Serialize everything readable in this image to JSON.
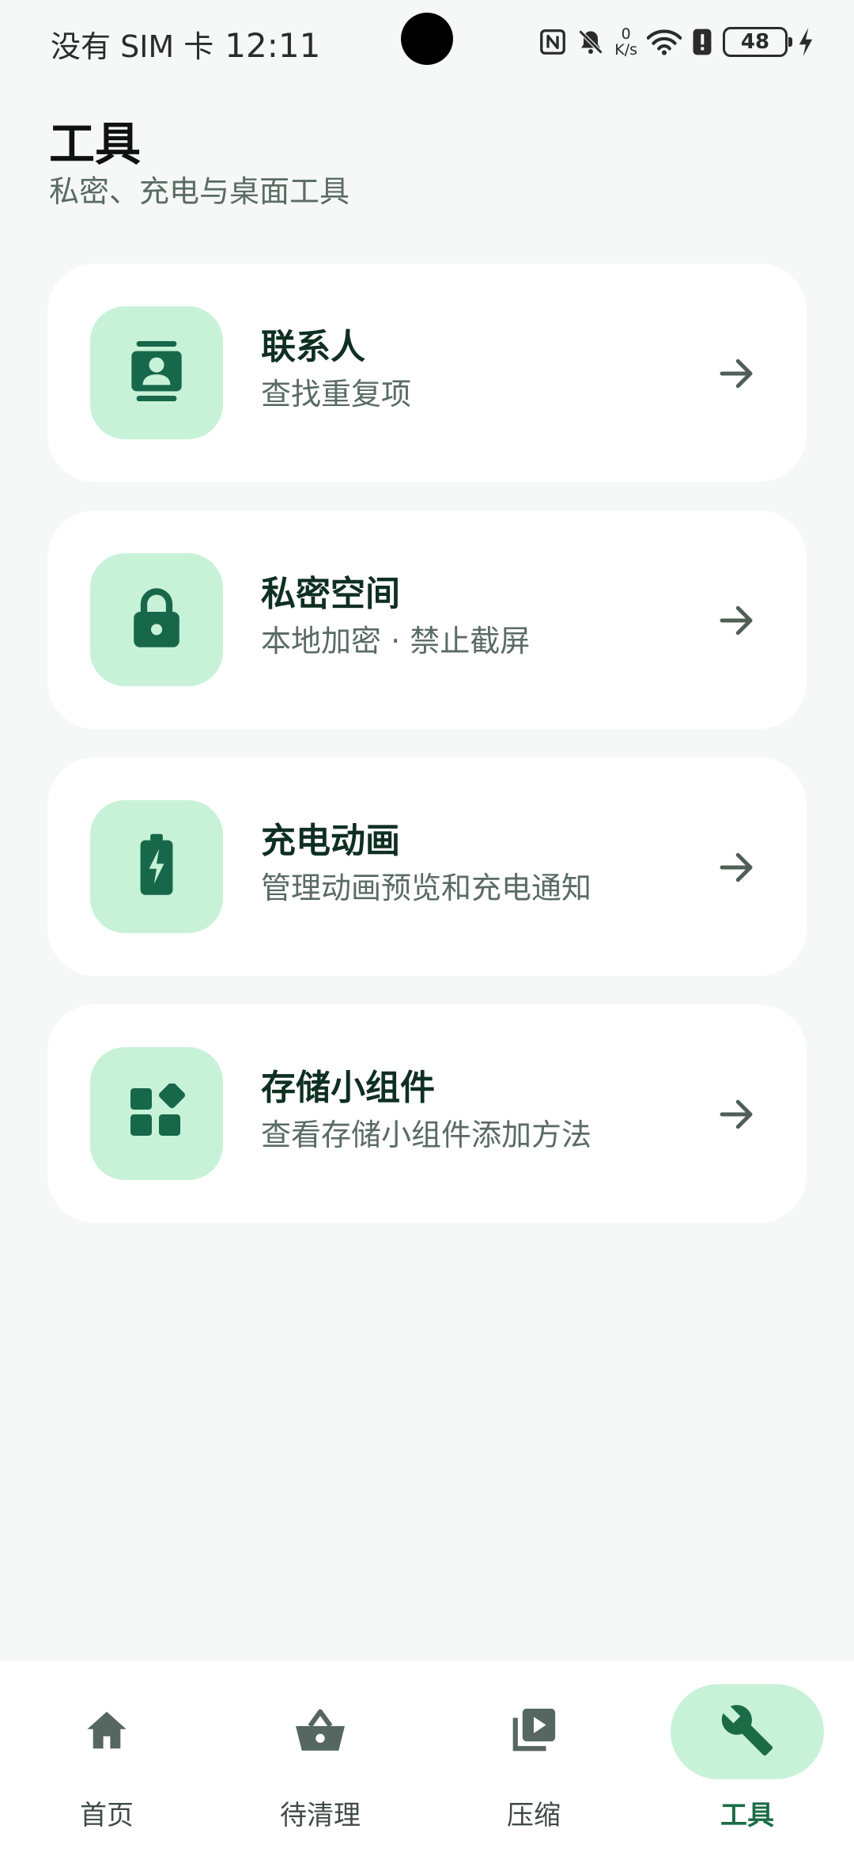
{
  "status_bar": {
    "carrier": "没有 SIM 卡",
    "time": "12:11",
    "net_speed_value": "0",
    "net_speed_unit": "K/s",
    "battery_level": "48",
    "icons": [
      "nfc-icon",
      "mute-icon",
      "wifi-icon",
      "alert-icon",
      "battery-icon",
      "charging-icon"
    ]
  },
  "header": {
    "title": "工具",
    "subtitle": "私密、充电与桌面工具"
  },
  "tools": [
    {
      "title": "联系人",
      "desc": "查找重复项",
      "icon": "contacts-icon"
    },
    {
      "title": "私密空间",
      "desc": "本地加密 · 禁止截屏",
      "icon": "lock-icon"
    },
    {
      "title": "充电动画",
      "desc": "管理动画预览和充电通知",
      "icon": "battery-charging-icon"
    },
    {
      "title": "存储小组件",
      "desc": "查看存储小组件添加方法",
      "icon": "widgets-icon"
    }
  ],
  "nav": {
    "active": "工具",
    "items": [
      {
        "label": "首页",
        "icon": "home-icon"
      },
      {
        "label": "待清理",
        "icon": "basket-icon"
      },
      {
        "label": "压缩",
        "icon": "video-library-icon"
      },
      {
        "label": "工具",
        "icon": "wrench-icon"
      }
    ]
  },
  "colors": {
    "background": "#f5f8f6",
    "card": "#ffffff",
    "icon_bg": "#c8f2d8",
    "icon_fg": "#17684a",
    "accent": "#1b6b46"
  }
}
